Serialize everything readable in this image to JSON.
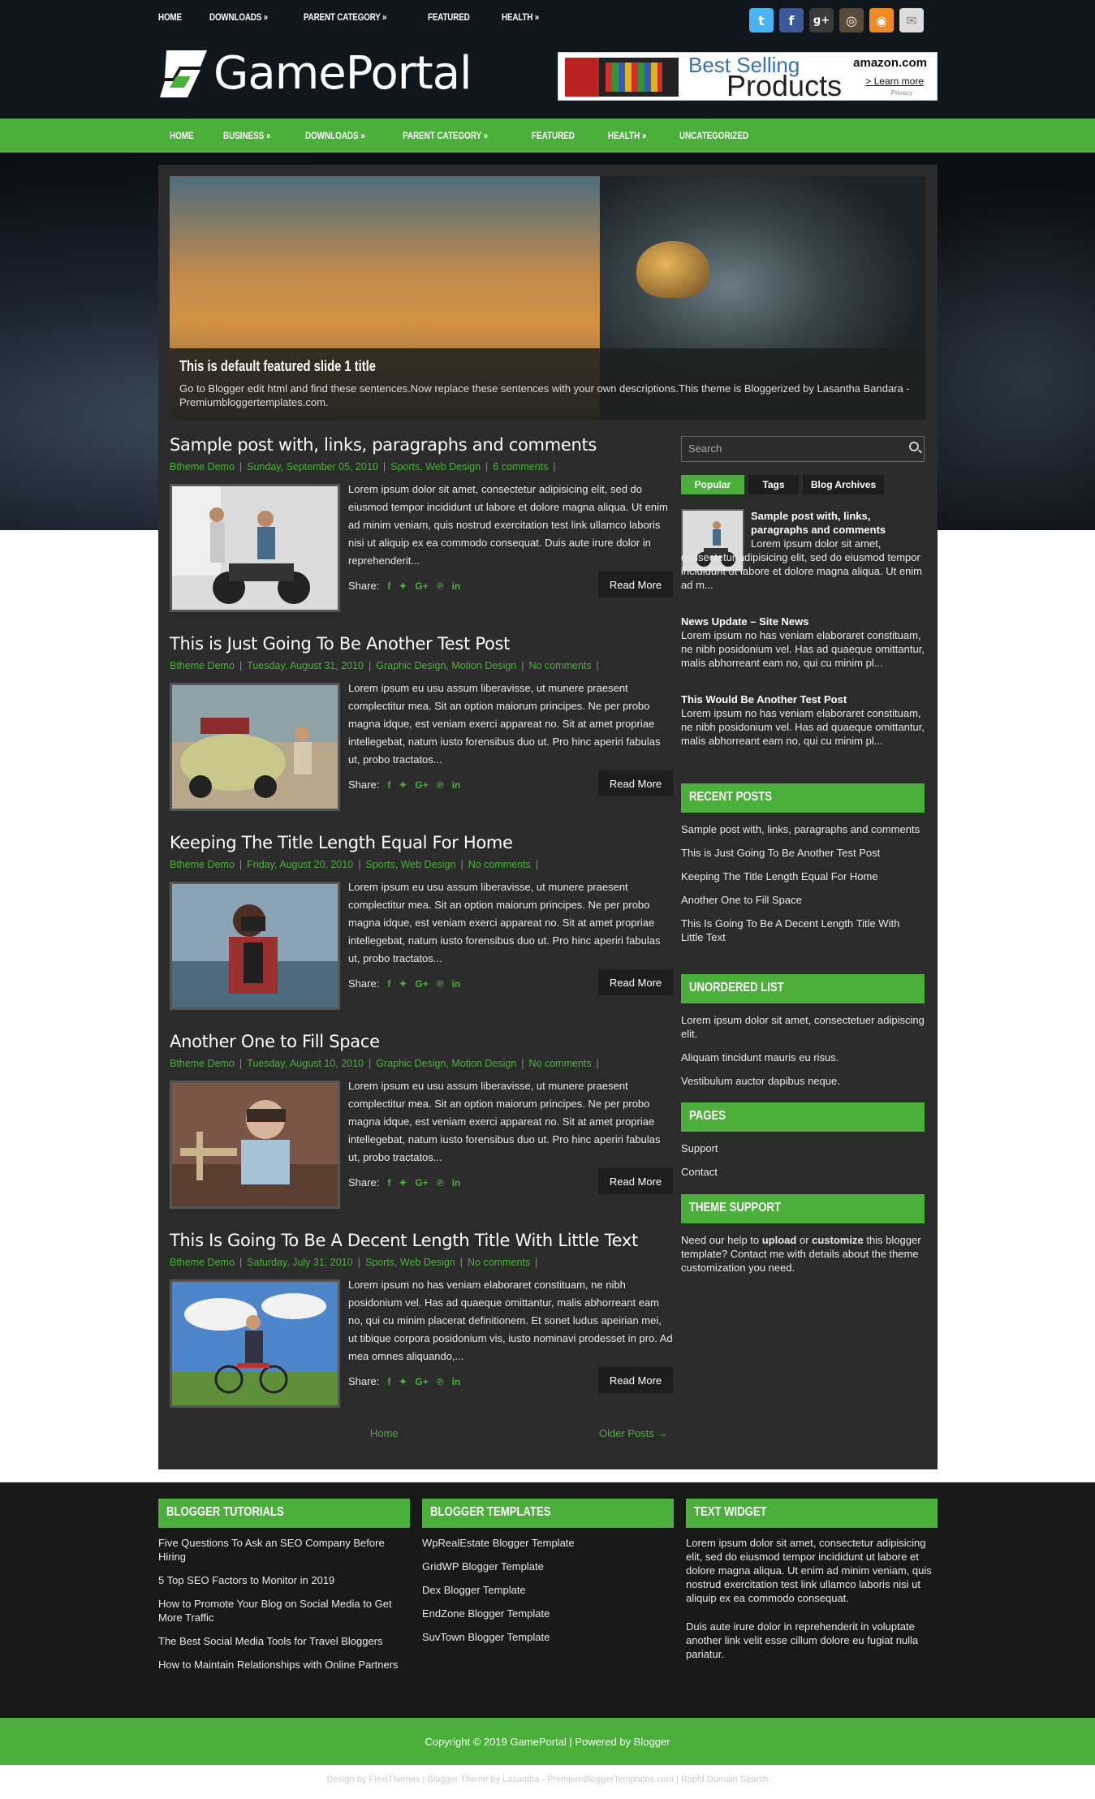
{
  "top_nav": [
    "HOME",
    "DOWNLOADS »",
    "PARENT CATEGORY »",
    "FEATURED",
    "HEALTH »"
  ],
  "social": [
    {
      "icon": "twitter-icon",
      "glyph": "t",
      "color": "#4ab3f4"
    },
    {
      "icon": "facebook-icon",
      "glyph": "f",
      "color": "#3b5998"
    },
    {
      "icon": "google-plus-icon",
      "glyph": "g+",
      "color": "#3a3a3a"
    },
    {
      "icon": "instagram-icon",
      "glyph": "◎",
      "color": "#5a4a3a"
    },
    {
      "icon": "rss-icon",
      "glyph": "◉",
      "color": "#f08a24"
    },
    {
      "icon": "mail-icon",
      "glyph": "✉",
      "color": "#dcdcdc"
    }
  ],
  "logo": {
    "text": "GamePortal"
  },
  "ad": {
    "line1": "Best Selling",
    "line2": "Products",
    "brand": "amazon.com",
    "learn": "> Learn more",
    "privacy": "Privacy"
  },
  "main_nav": [
    "HOME",
    "BUSINESS »",
    "DOWNLOADS »",
    "PARENT CATEGORY »",
    "FEATURED",
    "HEALTH »",
    "UNCATEGORIZED"
  ],
  "slide": {
    "title": "This is default featured slide 1 title",
    "desc": "Go to Blogger edit html and find these sentences.Now replace these sentences with your own descriptions.This theme is Bloggerized by Lasantha Bandara - Premiumbloggertemplates.com."
  },
  "posts": [
    {
      "title": "Sample post with, links, paragraphs and comments",
      "author": "Btheme Demo",
      "date": "Sunday, September 05, 2010",
      "labels": "Sports, Web Design",
      "comments": "6 comments",
      "excerpt": "Lorem ipsum dolor sit amet, consectetur adipisicing elit, sed do eiusmod tempor incididunt ut labore et dolore magna aliqua. Ut enim ad minim veniam, quis nostrud exercitation test link ullamco laboris nisi ut aliquip ex ea commodo consequat. Duis aute irure dolor in reprehenderit..."
    },
    {
      "title": "This is Just Going To Be Another Test Post",
      "author": "Btheme Demo",
      "date": "Tuesday, August 31, 2010",
      "labels": "Graphic Design, Motion Design",
      "comments": "No comments",
      "excerpt": "Lorem ipsum eu usu assum liberavisse, ut munere praesent complectitur mea. Sit an option maiorum principes. Ne per probo magna idque, est veniam exerci appareat no. Sit at amet propriae intellegebat, natum iusto forensibus duo ut. Pro hinc aperiri fabulas ut, probo tractatos..."
    },
    {
      "title": "Keeping The Title Length Equal For Home",
      "author": "Btheme Demo",
      "date": "Friday, August 20, 2010",
      "labels": "Sports, Web Design",
      "comments": "No comments",
      "excerpt": "Lorem ipsum eu usu assum liberavisse, ut munere praesent complectitur mea. Sit an option maiorum principes. Ne per probo magna idque, est veniam exerci appareat no. Sit at amet propriae intellegebat, natum iusto forensibus duo ut. Pro hinc aperiri fabulas ut, probo tractatos..."
    },
    {
      "title": "Another One to Fill Space",
      "author": "Btheme Demo",
      "date": "Tuesday, August 10, 2010",
      "labels": "Graphic Design, Motion Design",
      "comments": "No comments",
      "excerpt": "Lorem ipsum eu usu assum liberavisse, ut munere praesent complectitur mea. Sit an option maiorum principes. Ne per probo magna idque, est veniam exerci appareat no. Sit at amet propriae intellegebat, natum iusto forensibus duo ut. Pro hinc aperiri fabulas ut, probo tractatos..."
    },
    {
      "title": "This Is Going To Be A Decent Length Title With Little Text",
      "author": "Btheme Demo",
      "date": "Saturday, July 31, 2010",
      "labels": "Sports, Web Design",
      "comments": "No comments",
      "excerpt": "Lorem ipsum no has veniam elaboraret constituam, ne nibh posidonium vel. Has ad quaeque omittantur, malis abhorreant eam no, qui cu minim placerat definitionem. Et sonet ludus apeirian mei, ut tibique corpora posidonium vis, iusto nominavi prodesset in pro. Ad mea omnes aliquando,..."
    }
  ],
  "post_ui": {
    "share": "Share:",
    "read_more": "Read More",
    "share_icons": [
      "f",
      "♥",
      "G+",
      "℗",
      "in"
    ]
  },
  "pager": {
    "home": "Home",
    "older": "Older Posts →"
  },
  "sidebar": {
    "search_placeholder": "Search",
    "tabs": [
      "Popular",
      "Tags",
      "Blog Archives"
    ],
    "popular": [
      {
        "title": "Sample post with, links, paragraphs and comments",
        "text": "Lorem ipsum dolor sit amet, consectetur adipisicing elit, sed do eiusmod tempor incididunt ut labore et dolore magna aliqua. Ut enim ad m..."
      },
      {
        "title": "News Update – Site News",
        "text": "Lorem ipsum no has veniam elaboraret constituam, ne nibh posidonium vel. Has ad quaeque omittantur, malis abhorreant eam no, qui cu minim pl..."
      },
      {
        "title": "This Would Be Another Test Post",
        "text": "Lorem ipsum no has veniam elaboraret constituam, ne nibh posidonium vel. Has ad quaeque omittantur, malis abhorreant eam no, qui cu minim pl..."
      }
    ],
    "recent_title": "RECENT POSTS",
    "recent": [
      "Sample post with, links, paragraphs and comments",
      "This is Just Going To Be Another Test Post",
      "Keeping The Title Length Equal For Home",
      "Another One to Fill Space",
      "This Is Going To Be A Decent Length Title With Little Text"
    ],
    "ul_title": "UNORDERED LIST",
    "ul": [
      "Lorem ipsum dolor sit amet, consectetuer adipiscing elit.",
      "Aliquam tincidunt mauris eu risus.",
      "Vestibulum auctor dapibus neque."
    ],
    "pages_title": "PAGES",
    "pages": [
      "Support",
      "Contact"
    ],
    "support_title": "THEME SUPPORT",
    "support_pre": "Need our help to ",
    "support_upload": "upload",
    "support_or": " or ",
    "support_customize": "customize",
    "support_post": " this blogger template? Contact me with details about the theme customization you need."
  },
  "footer": {
    "col1_title": "BLOGGER TUTORIALS",
    "col1": [
      "Five Questions To Ask an SEO Company Before Hiring",
      "5 Top SEO Factors to Monitor in 2019",
      "How to Promote Your Blog on Social Media to Get More Traffic",
      "The Best Social Media Tools for Travel Bloggers",
      "How to Maintain Relationships with Online Partners"
    ],
    "col2_title": "BLOGGER TEMPLATES",
    "col2": [
      "WpRealEstate Blogger Template",
      "GridWP Blogger Template",
      "Dex Blogger Template",
      "EndZone Blogger Template",
      "SuvTown Blogger Template"
    ],
    "col3_title": "TEXT WIDGET",
    "col3_p1": "Lorem ipsum dolor sit amet, consectetur adipisicing elit, sed do eiusmod tempor incididunt ut labore et dolore magna aliqua. Ut enim ad minim veniam, quis nostrud exercitation test link ullamco laboris nisi ut aliquip ex ea commodo consequat.",
    "col3_p2": "Duis aute irure dolor in reprehenderit in voluptate another link velit esse cillum dolore eu fugiat nulla pariatur.",
    "copyright": "Copyright © 2019 GamePortal | Powered by Blogger",
    "credit": "Design by FlexiThemes | Blogger Theme by Lasantha - PremiumBloggerTemplates.com | Rapid Domain Search"
  },
  "colors": {
    "accent": "#4caf3c",
    "header_bg": "#0f161c",
    "panel_bg": "#2b2b2b"
  }
}
